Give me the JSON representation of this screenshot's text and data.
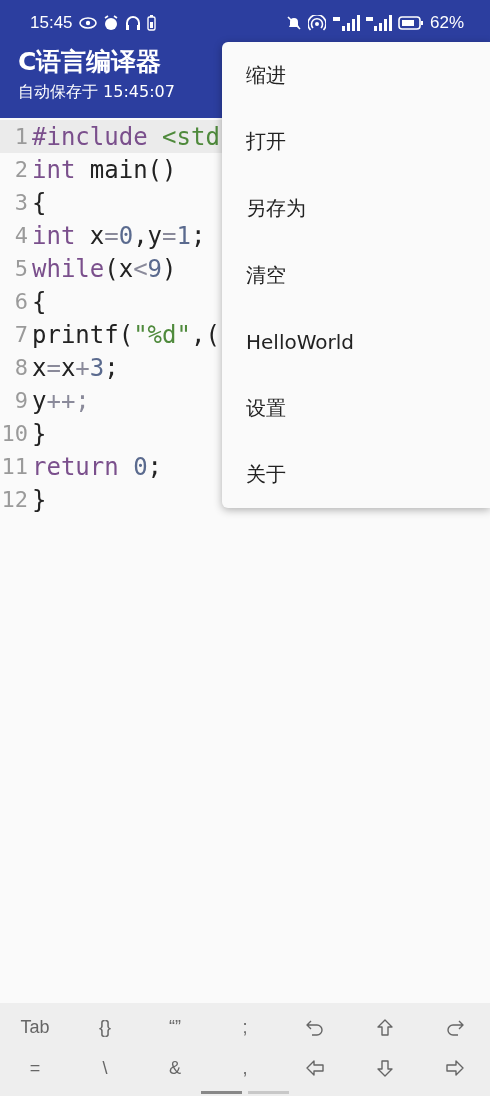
{
  "status_bar": {
    "time": "15:45",
    "battery": "62%"
  },
  "app_bar": {
    "title": "C语言编译器",
    "subtitle": "自动保存于 15:45:07"
  },
  "editor": {
    "lines": [
      {
        "number": "1",
        "current": true,
        "tokens": [
          {
            "kind": "keyword",
            "text": "#include"
          },
          {
            "kind": "string",
            "text": " <std"
          }
        ]
      },
      {
        "number": "2",
        "current": false,
        "tokens": [
          {
            "kind": "keyword",
            "text": "int"
          },
          {
            "kind": "plain",
            "text": " main()"
          }
        ]
      },
      {
        "number": "3",
        "current": false,
        "tokens": [
          {
            "kind": "plain",
            "text": "{"
          }
        ]
      },
      {
        "number": "4",
        "current": false,
        "tokens": [
          {
            "kind": "keyword",
            "text": "int"
          },
          {
            "kind": "plain",
            "text": " x"
          },
          {
            "kind": "operator",
            "text": "="
          },
          {
            "kind": "number",
            "text": "0"
          },
          {
            "kind": "plain",
            "text": ",y"
          },
          {
            "kind": "operator",
            "text": "="
          },
          {
            "kind": "number",
            "text": "1"
          },
          {
            "kind": "plain",
            "text": ";"
          }
        ]
      },
      {
        "number": "5",
        "current": false,
        "tokens": [
          {
            "kind": "keyword",
            "text": "while"
          },
          {
            "kind": "plain",
            "text": "(x"
          },
          {
            "kind": "operator",
            "text": "<"
          },
          {
            "kind": "number",
            "text": "9"
          },
          {
            "kind": "plain",
            "text": ")"
          }
        ]
      },
      {
        "number": "6",
        "current": false,
        "tokens": [
          {
            "kind": "plain",
            "text": "{"
          }
        ]
      },
      {
        "number": "7",
        "current": false,
        "tokens": [
          {
            "kind": "plain",
            "text": "printf("
          },
          {
            "kind": "string",
            "text": "\"%d\""
          },
          {
            "kind": "plain",
            "text": ",("
          }
        ]
      },
      {
        "number": "8",
        "current": false,
        "tokens": [
          {
            "kind": "plain",
            "text": "x"
          },
          {
            "kind": "operator",
            "text": "="
          },
          {
            "kind": "plain",
            "text": "x"
          },
          {
            "kind": "operator",
            "text": "+"
          },
          {
            "kind": "number",
            "text": "3"
          },
          {
            "kind": "plain",
            "text": ";"
          }
        ]
      },
      {
        "number": "9",
        "current": false,
        "tokens": [
          {
            "kind": "plain",
            "text": "y"
          },
          {
            "kind": "operator",
            "text": "++;"
          }
        ]
      },
      {
        "number": "10",
        "current": false,
        "tokens": [
          {
            "kind": "plain",
            "text": "}"
          }
        ]
      },
      {
        "number": "11",
        "current": false,
        "tokens": [
          {
            "kind": "keyword",
            "text": "return"
          },
          {
            "kind": "number",
            "text": " 0"
          },
          {
            "kind": "plain",
            "text": ";"
          }
        ]
      },
      {
        "number": "12",
        "current": false,
        "tokens": [
          {
            "kind": "plain",
            "text": "}"
          }
        ]
      }
    ]
  },
  "menu": {
    "items": [
      "缩进",
      "打开",
      "另存为",
      "清空",
      "HelloWorld",
      "设置",
      "关于"
    ]
  },
  "keyboard": {
    "rows": [
      [
        {
          "kind": "text",
          "label": "Tab"
        },
        {
          "kind": "text",
          "label": "{}"
        },
        {
          "kind": "text",
          "label": "“”"
        },
        {
          "kind": "text",
          "label": ";"
        },
        {
          "kind": "undo"
        },
        {
          "kind": "up"
        },
        {
          "kind": "redo"
        }
      ],
      [
        {
          "kind": "text",
          "label": "="
        },
        {
          "kind": "text",
          "label": "\\"
        },
        {
          "kind": "text",
          "label": "&"
        },
        {
          "kind": "text",
          "label": ","
        },
        {
          "kind": "left"
        },
        {
          "kind": "down"
        },
        {
          "kind": "right"
        }
      ]
    ],
    "pages": [
      {
        "selected": true
      },
      {
        "selected": false
      }
    ]
  }
}
